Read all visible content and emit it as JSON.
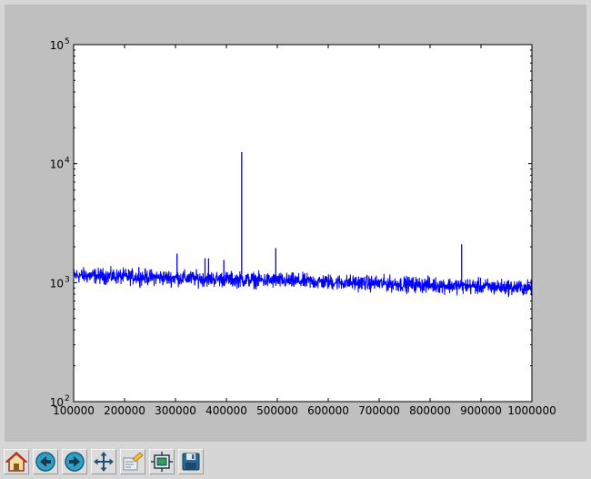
{
  "toolbar": {
    "buttons": [
      {
        "name": "home-button",
        "icon": "home-icon"
      },
      {
        "name": "back-button",
        "icon": "back-arrow-icon"
      },
      {
        "name": "forward-button",
        "icon": "forward-arrow-icon"
      },
      {
        "name": "pan-button",
        "icon": "move-arrows-icon"
      },
      {
        "name": "zoom-button",
        "icon": "zoom-rect-icon"
      },
      {
        "name": "subplots-button",
        "icon": "configure-subplots-icon"
      },
      {
        "name": "save-button",
        "icon": "floppy-disk-icon"
      }
    ]
  },
  "colors": {
    "figure_background": "#bfbfbf",
    "axes_background": "#ffffff",
    "line": "#0000ff"
  },
  "chart_data": {
    "type": "line",
    "title": "",
    "xlabel": "",
    "ylabel": "",
    "xlim": [
      100000,
      1000000
    ],
    "ylim": [
      100,
      100000
    ],
    "yscale": "log",
    "grid": false,
    "x_ticks": [
      {
        "value": 100000,
        "label": "100000"
      },
      {
        "value": 200000,
        "label": "200000"
      },
      {
        "value": 300000,
        "label": "300000"
      },
      {
        "value": 400000,
        "label": "400000"
      },
      {
        "value": 500000,
        "label": "500000"
      },
      {
        "value": 600000,
        "label": "600000"
      },
      {
        "value": 700000,
        "label": "700000"
      },
      {
        "value": 800000,
        "label": "800000"
      },
      {
        "value": 900000,
        "label": "900000"
      },
      {
        "value": 1000000,
        "label": "1000000"
      }
    ],
    "y_ticks": [
      {
        "value": 100,
        "base": "10",
        "exp": "2"
      },
      {
        "value": 1000,
        "base": "10",
        "exp": "3"
      },
      {
        "value": 10000,
        "base": "10",
        "exp": "4"
      },
      {
        "value": 100000,
        "base": "10",
        "exp": "5"
      }
    ],
    "baseline": {
      "x_start": 100000,
      "x_end": 1000000,
      "y_start": 1150,
      "y_end": 900,
      "noise_band": [
        0.8,
        1.25
      ]
    },
    "peaks": [
      {
        "x": 228000,
        "y": 1350
      },
      {
        "x": 303000,
        "y": 1750
      },
      {
        "x": 358000,
        "y": 1600
      },
      {
        "x": 365000,
        "y": 1600
      },
      {
        "x": 395000,
        "y": 1550
      },
      {
        "x": 430000,
        "y": 12500
      },
      {
        "x": 497000,
        "y": 1950
      },
      {
        "x": 862000,
        "y": 2100
      }
    ]
  }
}
